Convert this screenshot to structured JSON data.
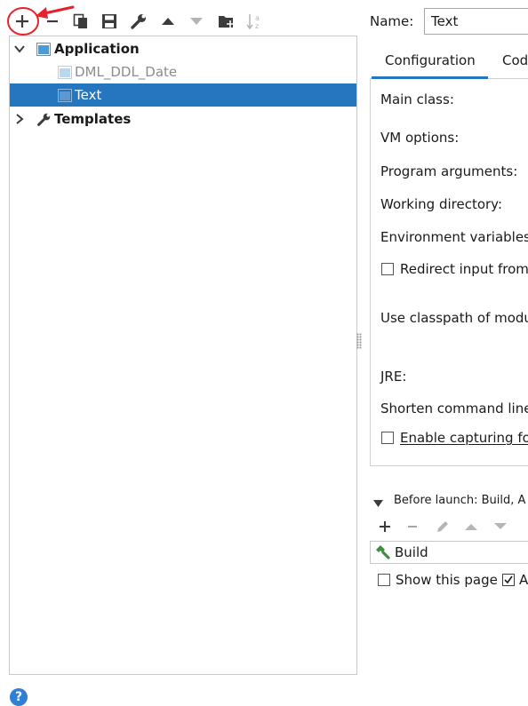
{
  "toolbar": {
    "items": [
      {
        "name": "add-icon",
        "enabled": true
      },
      {
        "name": "remove-icon",
        "enabled": true
      },
      {
        "name": "copy-icon",
        "enabled": true
      },
      {
        "name": "save-icon",
        "enabled": true
      },
      {
        "name": "wrench-icon",
        "enabled": true
      },
      {
        "name": "move-up-icon",
        "enabled": true
      },
      {
        "name": "move-down-icon",
        "enabled": false
      },
      {
        "name": "new-folder-icon",
        "enabled": true
      },
      {
        "name": "sort-alpha-icon",
        "enabled": false
      }
    ],
    "annotation_color": "#e8202a"
  },
  "tree": {
    "application": {
      "label": "Application",
      "expanded": true
    },
    "children": [
      {
        "label": "DML_DDL_Date",
        "state": "inactive"
      },
      {
        "label": "Text",
        "state": "selected"
      }
    ],
    "templates": {
      "label": "Templates",
      "expanded": false
    }
  },
  "name_field": {
    "label": "Name:",
    "value": "Text"
  },
  "tabs": [
    {
      "label": "Configuration",
      "active": true
    },
    {
      "label": "Cod",
      "active": false
    }
  ],
  "config_fields": {
    "main_class": "Main class:",
    "vm_options": "VM options:",
    "program_arguments": "Program arguments:",
    "working_directory": "Working directory:",
    "environment_variables": "Environment variables:",
    "redirect_input": "Redirect input from",
    "use_classpath": "Use classpath of modul",
    "jre": "JRE:",
    "shorten_command_line": "Shorten command line",
    "enable_capturing": "Enable capturing for"
  },
  "before_launch": {
    "title": "Before launch: Build, A",
    "task": "Build"
  },
  "bottom": {
    "show_this_page": "Show this page",
    "show_this_page_checked": false,
    "activate_checked": true,
    "activate_label": "A"
  },
  "colors": {
    "selection": "#2675bf",
    "accent": "#2675bf",
    "help": "#2f7fd8"
  }
}
